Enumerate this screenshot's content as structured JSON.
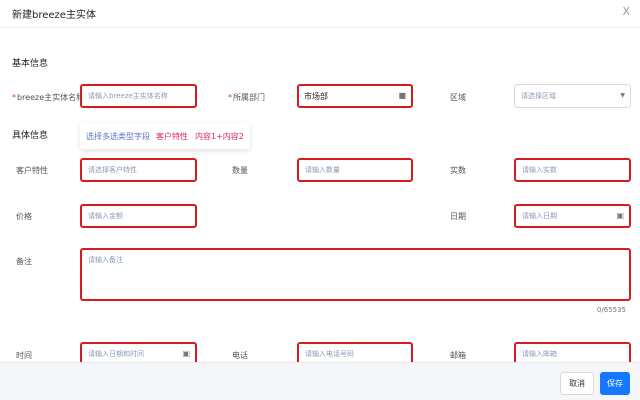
{
  "dialog": {
    "title": "新建breeze主实体",
    "close_symbol": "X"
  },
  "sections": {
    "basic": "基本信息",
    "detail": "具体信息"
  },
  "fields": {
    "name": {
      "label": "breeze主实体名称",
      "required_mark": "*",
      "placeholder": "请输入breeze主实体名称"
    },
    "department": {
      "label": "所属部门",
      "required_mark": "*",
      "value": "市场部"
    },
    "region": {
      "label": "区域",
      "placeholder": "请选择区域"
    },
    "customer_trait": {
      "label": "客户特性",
      "placeholder": "请选择客户特性"
    },
    "quantity": {
      "label": "数量",
      "placeholder": "请输入数量"
    },
    "real_number": {
      "label": "实数",
      "placeholder": "请输入实数"
    },
    "price": {
      "label": "价格",
      "placeholder": "请输入金额"
    },
    "date": {
      "label": "日期",
      "placeholder": "请输入日期"
    },
    "remark": {
      "label": "备注",
      "placeholder": "请输入备注",
      "counter": "0/65535"
    },
    "time": {
      "label": "时间",
      "placeholder": "请输入日期和时间"
    },
    "phone": {
      "label": "电话",
      "placeholder": "请输入电话号码"
    },
    "email": {
      "label": "邮箱",
      "placeholder": "请输入邮箱"
    }
  },
  "dropdown": {
    "option_1": "选择多选类型字段",
    "option_2": "客户特性",
    "option_3": "内容1+内容2"
  },
  "footer": {
    "cancel_label": "取消",
    "save_label": "保存"
  },
  "colors": {
    "error_border": "#d71920",
    "primary": "#1677ff",
    "dropdown_blue": "#5b73c7",
    "dropdown_pink": "#e0246e"
  }
}
